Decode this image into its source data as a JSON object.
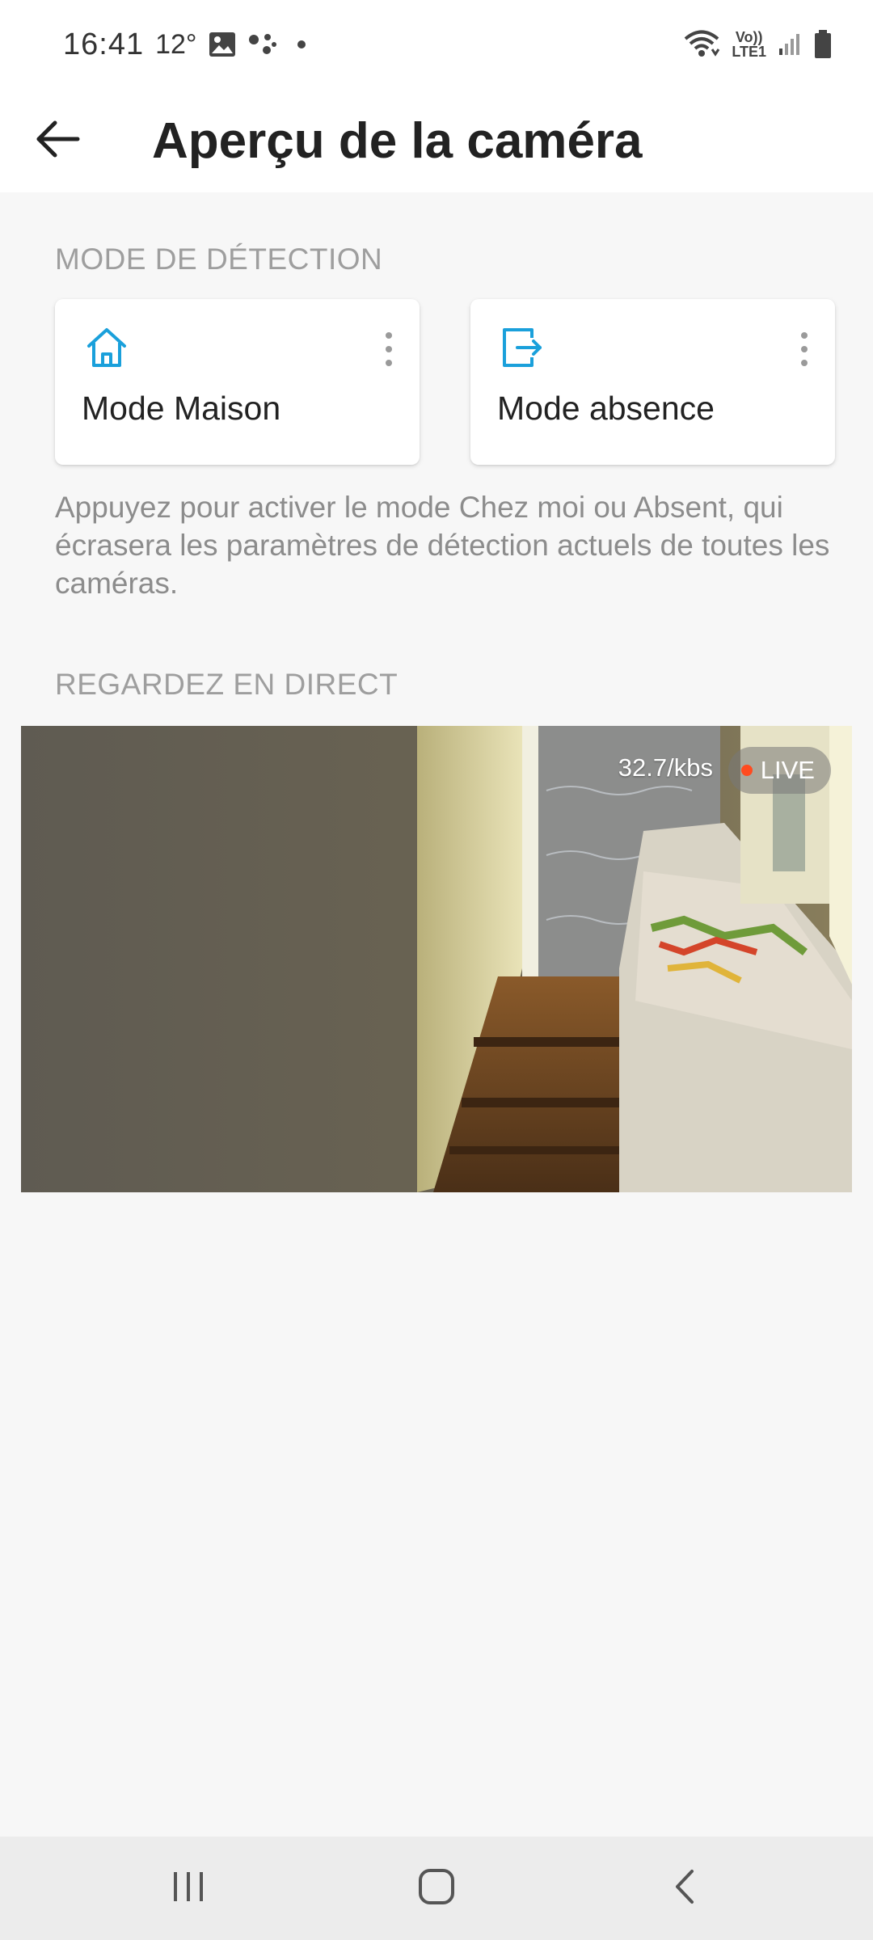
{
  "status_bar": {
    "time": "16:41",
    "temperature": "12°",
    "icons": [
      "image-icon",
      "assistant-dots-icon",
      "notification-dot-icon",
      "wifi-icon",
      "volte-icon",
      "signal-icon",
      "battery-icon"
    ],
    "volte_top": "Vo))",
    "volte_bottom": "LTE1"
  },
  "app_bar": {
    "title": "Aperçu de la caméra",
    "back_icon": "arrow-back-icon"
  },
  "detection": {
    "section_title": "MODE DE DÉTECTION",
    "cards": [
      {
        "label": "Mode Maison",
        "icon": "home-icon"
      },
      {
        "label": "Mode absence",
        "icon": "exit-icon"
      }
    ],
    "description": "Appuyez pour activer le mode Chez moi ou Absent, qui écrasera les paramètres de détection actuels de toutes les caméras."
  },
  "live": {
    "section_title": "REGARDEZ EN DIRECT",
    "bitrate": "32.7/kbs",
    "badge": "LIVE"
  },
  "colors": {
    "accent": "#1aa0db",
    "background": "#f7f7f7",
    "live_dot": "#ff4b1f"
  },
  "nav_bar": {
    "icons": [
      "recent-apps-icon",
      "home-nav-icon",
      "back-nav-icon"
    ]
  }
}
